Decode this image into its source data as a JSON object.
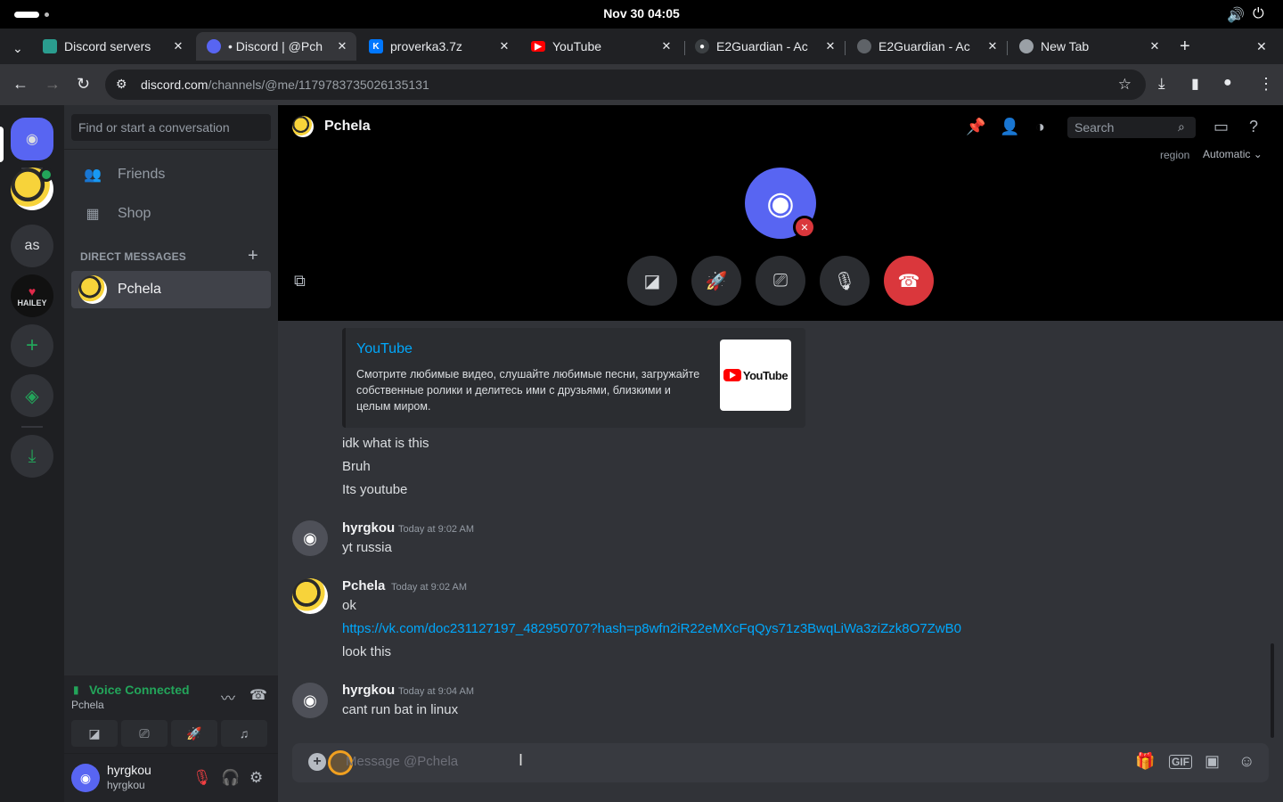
{
  "system": {
    "clock": "Nov 30  04:05",
    "volume_icon": "🔊",
    "power_icon": "⏻"
  },
  "browser": {
    "tabs": [
      {
        "title": "Discord servers",
        "favicon_color": "#2a9d8f"
      },
      {
        "title": "• Discord | @Pch",
        "favicon_color": "#5865f2"
      },
      {
        "title": "proverka3.7z",
        "favicon_color": "#0077ff"
      },
      {
        "title": "YouTube",
        "favicon_color": "#ff0000"
      },
      {
        "title": "E2Guardian - Ac",
        "favicon_color": "#9aa0a6"
      },
      {
        "title": "E2Guardian - Ac",
        "favicon_color": "#9aa0a6"
      },
      {
        "title": "New Tab",
        "favicon_color": "#9aa0a6"
      }
    ],
    "url_host": "discord.com",
    "url_path": "/channels/@me/1179783735026135131"
  },
  "guilds": {
    "as_label": "as",
    "hailey_label": "HAILEY"
  },
  "dm_sidebar": {
    "search_placeholder": "Find or start a conversation",
    "friends": "Friends",
    "shop": "Shop",
    "direct_messages": "DIRECT MESSAGES",
    "dm_user": "Pchela"
  },
  "voice": {
    "status": "Voice Connected",
    "channel": "Pchela"
  },
  "user": {
    "name": "hyrgkou",
    "tag": "hyrgkou"
  },
  "header": {
    "title": "Pchela",
    "search_placeholder": "Search",
    "region_label": "region",
    "region_value": "Automatic ⌄"
  },
  "embed": {
    "title": "YouTube",
    "description": "Смотрите любимые видео, слушайте любимые песни, загружайте собственные ролики и делитесь ими с друзьями, близкими и целым миром.",
    "thumb_text": "YouTube"
  },
  "messages": {
    "l1": "idk what is this",
    "l2": "Bruh",
    "l3": "Its youtube",
    "m1_author": "hyrgkou",
    "m1_time": "Today at 9:02 AM",
    "m1_text": "yt russia",
    "m2_author": "Pchela",
    "m2_time": "Today at 9:02 AM",
    "m2_text": "ok",
    "m2_link": "https://vk.com/doc231127197_482950707?hash=p8wfn2iR22eMXcFqQys71z3BwqLiWa3ziZzk8O7ZwB0",
    "m2_text2": "look this",
    "m3_author": "hyrgkou",
    "m3_time": "Today at 9:04 AM",
    "m3_text": "cant run bat in linux"
  },
  "composer": {
    "placeholder": "Message @Pchela"
  }
}
